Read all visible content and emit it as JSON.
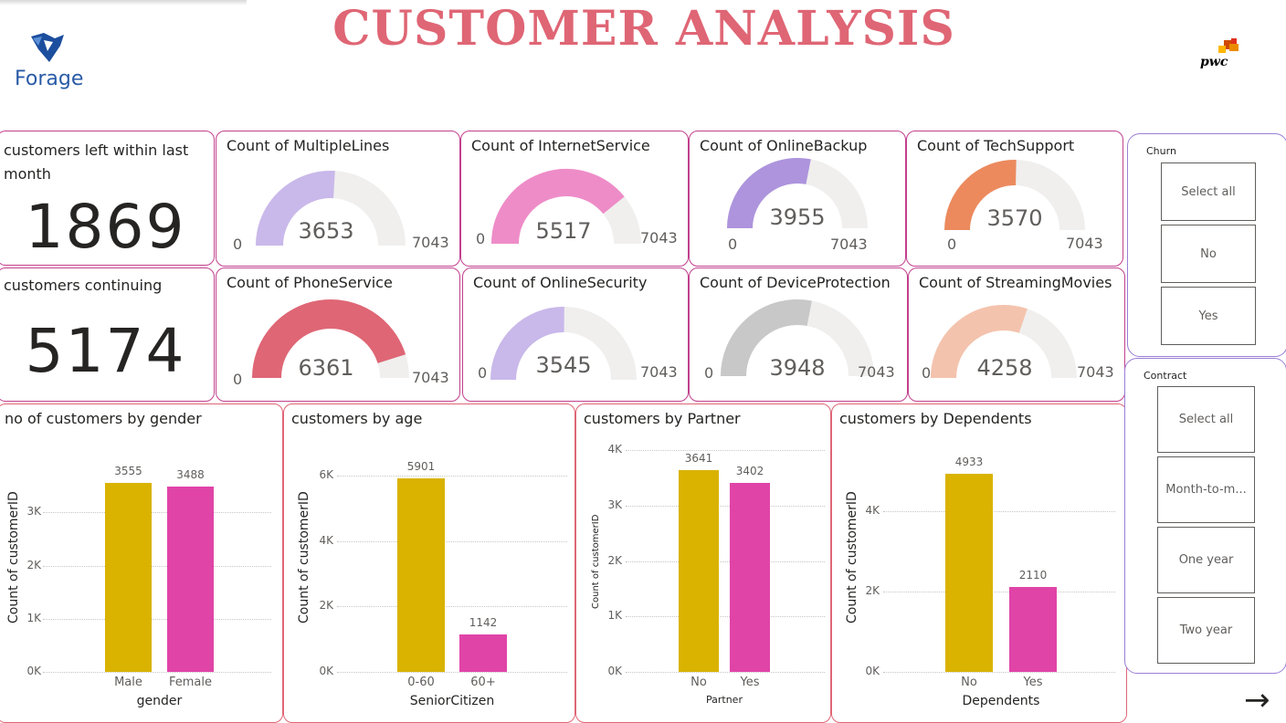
{
  "title": "CUSTOMER ANALYSIS",
  "logos": {
    "left": "Forage",
    "right": "pwc"
  },
  "kpis": [
    {
      "label": "customers left within last month",
      "value": "1869"
    },
    {
      "label": "customers continuing",
      "value": "5174"
    }
  ],
  "gauges": [
    {
      "title": "Count of MultipleLines",
      "value": 3653,
      "min": 0,
      "max": 7043,
      "color": "#c9b8ea"
    },
    {
      "title": "Count of InternetService",
      "value": 5517,
      "min": 0,
      "max": 7043,
      "color": "#ee8cc8"
    },
    {
      "title": "Count of OnlineBackup",
      "value": 3955,
      "min": 0,
      "max": 7043,
      "color": "#ad94dd"
    },
    {
      "title": "Count of TechSupport",
      "value": 3570,
      "min": 0,
      "max": 7043,
      "color": "#ec8a5e"
    },
    {
      "title": "Count of PhoneService",
      "value": 6361,
      "min": 0,
      "max": 7043,
      "color": "#df6675"
    },
    {
      "title": "Count of OnlineSecurity",
      "value": 3545,
      "min": 0,
      "max": 7043,
      "color": "#c9b8ea"
    },
    {
      "title": "Count of DeviceProtection",
      "value": 3948,
      "min": 0,
      "max": 7043,
      "color": "#c8c8c8"
    },
    {
      "title": "Count of StreamingMovies",
      "value": 4258,
      "min": 0,
      "max": 7043,
      "color": "#f4c3ad"
    }
  ],
  "chart_data": [
    {
      "type": "bar",
      "title": "no of customers by gender",
      "categories": [
        "Male",
        "Female"
      ],
      "values": [
        3555,
        3488
      ],
      "xlabel": "gender",
      "ylabel": "Count of customerID",
      "ylim": [
        0,
        4000
      ],
      "yticks": [
        "0K",
        "1K",
        "2K",
        "3K"
      ],
      "ytick_values": [
        0,
        1000,
        2000,
        3000
      ],
      "colors": [
        "#d9b300",
        "#e044a7"
      ],
      "grid": true
    },
    {
      "type": "bar",
      "title": "customers by age",
      "categories": [
        "0-60",
        "60+"
      ],
      "values": [
        5901,
        1142
      ],
      "xlabel": "SeniorCitizen",
      "ylabel": "Count of customerID",
      "ylim": [
        0,
        6500
      ],
      "yticks": [
        "0K",
        "2K",
        "4K",
        "6K"
      ],
      "ytick_values": [
        0,
        2000,
        4000,
        6000
      ],
      "colors": [
        "#d9b300",
        "#e044a7"
      ],
      "grid": true
    },
    {
      "type": "bar",
      "title": "customers by Partner",
      "categories": [
        "No",
        "Yes"
      ],
      "values": [
        3641,
        3402
      ],
      "xlabel": "Partner",
      "ylabel": "Count of customerID",
      "ylim": [
        0,
        4000
      ],
      "yticks": [
        "0K",
        "1K",
        "2K",
        "3K",
        "4K"
      ],
      "ytick_values": [
        0,
        1000,
        2000,
        3000,
        4000
      ],
      "colors": [
        "#d9b300",
        "#e044a7"
      ],
      "grid": true
    },
    {
      "type": "bar",
      "title": "customers by Dependents",
      "categories": [
        "No",
        "Yes"
      ],
      "values": [
        4933,
        2110
      ],
      "xlabel": "Dependents",
      "ylabel": "Count of customerID",
      "ylim": [
        0,
        5300
      ],
      "yticks": [
        "0K",
        "2K",
        "4K"
      ],
      "ytick_values": [
        0,
        2000,
        4000
      ],
      "colors": [
        "#d9b300",
        "#e044a7"
      ],
      "grid": true
    }
  ],
  "slicers": [
    {
      "title": "Churn",
      "options": [
        "Select all",
        "No",
        "Yes"
      ]
    },
    {
      "title": "Contract",
      "options": [
        "Select all",
        "Month-to-m...",
        "One year",
        "Two year"
      ]
    }
  ],
  "nav": {
    "next_icon": "arrow-right-icon",
    "next_glyph": "→"
  }
}
